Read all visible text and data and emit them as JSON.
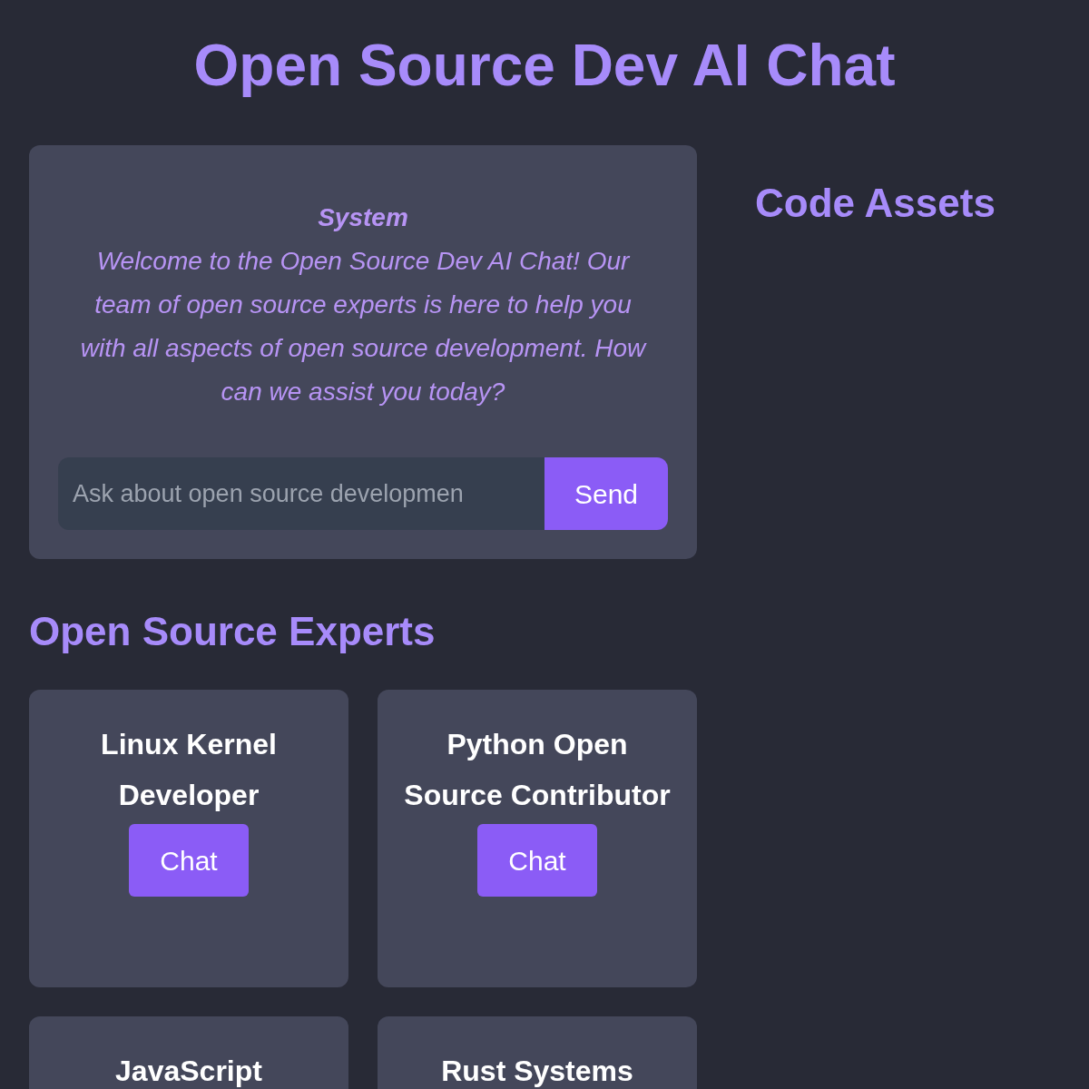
{
  "title": "Open Source Dev AI Chat",
  "chat": {
    "messages": [
      {
        "sender": "System",
        "text": "Welcome to the Open Source Dev AI Chat! Our team of open source experts is here to help you with all aspects of open source development. How can we assist you today?"
      }
    ],
    "input": {
      "placeholder": "Ask about open source developmen"
    },
    "send_button": "Send"
  },
  "experts": {
    "heading": "Open Source Experts",
    "cards": [
      {
        "name": "Linux Kernel Developer",
        "button": "Chat"
      },
      {
        "name": "Python Open Source Contributor",
        "button": "Chat"
      },
      {
        "name": "JavaScript"
      },
      {
        "name": "Rust Systems"
      }
    ]
  },
  "assets": {
    "heading": "Code Assets"
  }
}
